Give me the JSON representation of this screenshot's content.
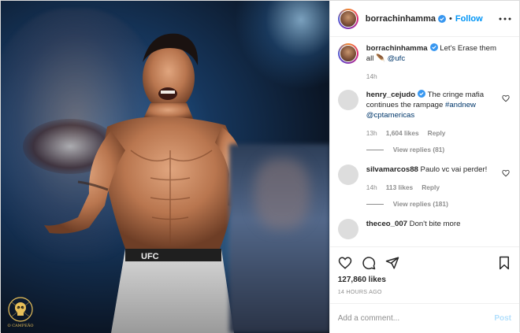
{
  "colors": {
    "link_blue": "#0095f6",
    "mention_blue": "#00376b",
    "muted": "#8e8e8e",
    "post_disabled": "#b2dffc"
  },
  "header": {
    "username": "borrachinhamma",
    "separator": "•",
    "follow_label": "Follow",
    "more_icon": "more-horizontal-icon"
  },
  "caption": {
    "username": "borrachinhamma",
    "text": " Let's Erase them all 🪶 ",
    "mention": "@ufc",
    "time": "14h"
  },
  "comments": [
    {
      "username": "henry_cejudo",
      "verified": true,
      "text": " The cringe mafia continues the rampage ",
      "hashtags": "#andnew @cptamericas",
      "time": "13h",
      "likes": "1,604 likes",
      "reply_label": "Reply",
      "view_replies": "View replies (81)"
    },
    {
      "username": "silvamarcos88",
      "verified": false,
      "text": " Paulo vc vai perder!",
      "time": "14h",
      "likes": "113 likes",
      "reply_label": "Reply",
      "view_replies": "View replies (181)"
    },
    {
      "username": "theceo_007",
      "text": " Don't bite more"
    }
  ],
  "actions": {
    "likes_count": "127,860 likes",
    "timestamp": "14 HOURS AGO"
  },
  "add_comment": {
    "placeholder": "Add a comment...",
    "post_label": "Post"
  },
  "media": {
    "shorts_text": "UFC",
    "watermark_text": "O CAMPEÃO"
  }
}
